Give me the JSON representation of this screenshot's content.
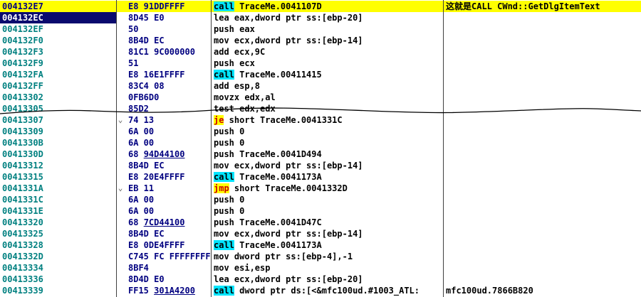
{
  "rows": [
    {
      "addr": "004132E7",
      "bytes": "E8 91DDFFFF",
      "bytes_ul": "",
      "mn": "call",
      "mn_kind": "call",
      "ops": " TraceMe.0041107D",
      "comment": "这就是CALL CWnd::GetDlgItemText",
      "highlight": true
    },
    {
      "addr": "004132EC",
      "bytes": "8D45 E0",
      "bytes_ul": "",
      "mn": "",
      "mn_kind": "",
      "ops": "lea eax,dword ptr ss:[ebp-20]",
      "comment": "",
      "selected": true
    },
    {
      "addr": "004132EF",
      "bytes": "50",
      "bytes_ul": "",
      "mn": "",
      "mn_kind": "",
      "ops": "push eax",
      "comment": ""
    },
    {
      "addr": "004132F0",
      "bytes": "8B4D EC",
      "bytes_ul": "",
      "mn": "",
      "mn_kind": "",
      "ops": "mov ecx,dword ptr ss:[ebp-14]",
      "comment": ""
    },
    {
      "addr": "004132F3",
      "bytes": "81C1 9C000000",
      "bytes_ul": "",
      "mn": "",
      "mn_kind": "",
      "ops": "add ecx,9C",
      "comment": ""
    },
    {
      "addr": "004132F9",
      "bytes": "51",
      "bytes_ul": "",
      "mn": "",
      "mn_kind": "",
      "ops": "push ecx",
      "comment": ""
    },
    {
      "addr": "004132FA",
      "bytes": "E8 16E1FFFF",
      "bytes_ul": "",
      "mn": "call",
      "mn_kind": "call",
      "ops": " TraceMe.00411415",
      "comment": ""
    },
    {
      "addr": "004132FF",
      "bytes": "83C4 08",
      "bytes_ul": "",
      "mn": "",
      "mn_kind": "",
      "ops": "add esp,8",
      "comment": ""
    },
    {
      "addr": "00413302",
      "bytes": "0FB6D0",
      "bytes_ul": "",
      "mn": "",
      "mn_kind": "",
      "ops": "movzx edx,al",
      "comment": ""
    },
    {
      "addr": "00413305",
      "bytes": "85D2",
      "bytes_ul": "",
      "mn": "",
      "mn_kind": "",
      "ops": "test edx,edx",
      "comment": ""
    },
    {
      "addr": "00413307",
      "bytes": "74 13",
      "bytes_ul": "",
      "mn": "je",
      "mn_kind": "jump",
      "ops": " short TraceMe.0041331C",
      "comment": "",
      "jmark": "⌄"
    },
    {
      "addr": "00413309",
      "bytes": "6A 00",
      "bytes_ul": "",
      "mn": "",
      "mn_kind": "",
      "ops": "push 0",
      "comment": ""
    },
    {
      "addr": "0041330B",
      "bytes": "6A 00",
      "bytes_ul": "",
      "mn": "",
      "mn_kind": "",
      "ops": "push 0",
      "comment": ""
    },
    {
      "addr": "0041330D",
      "bytes": "68 ",
      "bytes_ul": "94D44100",
      "mn": "",
      "mn_kind": "",
      "ops": "push TraceMe.0041D494",
      "comment": ""
    },
    {
      "addr": "00413312",
      "bytes": "8B4D EC",
      "bytes_ul": "",
      "mn": "",
      "mn_kind": "",
      "ops": "mov ecx,dword ptr ss:[ebp-14]",
      "comment": ""
    },
    {
      "addr": "00413315",
      "bytes": "E8 20E4FFFF",
      "bytes_ul": "",
      "mn": "call",
      "mn_kind": "call",
      "ops": " TraceMe.0041173A",
      "comment": ""
    },
    {
      "addr": "0041331A",
      "bytes": "EB 11",
      "bytes_ul": "",
      "mn": "jmp",
      "mn_kind": "jump",
      "ops": " short TraceMe.0041332D",
      "comment": "",
      "jmark": "⌄"
    },
    {
      "addr": "0041331C",
      "bytes": "6A 00",
      "bytes_ul": "",
      "mn": "",
      "mn_kind": "",
      "ops": "push 0",
      "comment": ""
    },
    {
      "addr": "0041331E",
      "bytes": "6A 00",
      "bytes_ul": "",
      "mn": "",
      "mn_kind": "",
      "ops": "push 0",
      "comment": ""
    },
    {
      "addr": "00413320",
      "bytes": "68 ",
      "bytes_ul": "7CD44100",
      "mn": "",
      "mn_kind": "",
      "ops": "push TraceMe.0041D47C",
      "comment": ""
    },
    {
      "addr": "00413325",
      "bytes": "8B4D EC",
      "bytes_ul": "",
      "mn": "",
      "mn_kind": "",
      "ops": "mov ecx,dword ptr ss:[ebp-14]",
      "comment": ""
    },
    {
      "addr": "00413328",
      "bytes": "E8 0DE4FFFF",
      "bytes_ul": "",
      "mn": "call",
      "mn_kind": "call",
      "ops": " TraceMe.0041173A",
      "comment": ""
    },
    {
      "addr": "0041332D",
      "bytes": "C745 FC FFFFFFFF",
      "bytes_ul": "",
      "mn": "",
      "mn_kind": "",
      "ops": "mov dword ptr ss:[ebp-4],-1",
      "comment": ""
    },
    {
      "addr": "00413334",
      "bytes": "8BF4",
      "bytes_ul": "",
      "mn": "",
      "mn_kind": "",
      "ops": "mov esi,esp",
      "comment": ""
    },
    {
      "addr": "00413336",
      "bytes": "8D4D E0",
      "bytes_ul": "",
      "mn": "",
      "mn_kind": "",
      "ops": "lea ecx,dword ptr ss:[ebp-20]",
      "comment": ""
    },
    {
      "addr": "00413339",
      "bytes": "FF15 ",
      "bytes_ul": "301A4200",
      "mn": "call",
      "mn_kind": "call",
      "ops": " dword ptr ds:[<&mfc100ud.#1003_ATL:",
      "comment": "mfc100ud.7866B820"
    }
  ],
  "colors": {
    "highlight": "#ffff00",
    "selection": "#0a0a6e",
    "address": "#008080",
    "bytes": "#000080",
    "call_bg": "#00e5ff",
    "jump_bg": "#ffff00",
    "jump_fg": "#cc0000"
  }
}
